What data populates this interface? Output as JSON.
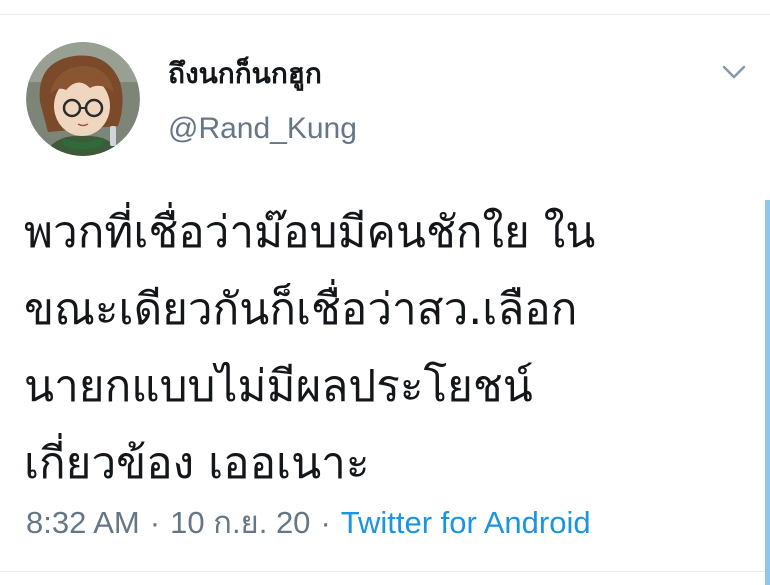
{
  "tweet": {
    "author": {
      "display_name": "ถึงนกก็นกฮูก",
      "handle": "@Rand_Kung"
    },
    "menu_icon": "chevron-down-icon",
    "text_lines": [
      "พวกที่เชื่อว่าม๊อบมีคนชักใย ใน",
      "ขณะเดียวกันก็เชื่อว่าสว.เลือก",
      "นายกแบบไม่มีผลประโยชน์",
      "เกี่ยวข้อง เออเนาะ"
    ],
    "time": "8:32 AM",
    "date": "10 ก.ย. 20",
    "separator": "·",
    "source": "Twitter for Android"
  },
  "colors": {
    "text_primary": "#14171a",
    "text_secondary": "#657786",
    "link": "#1b95e0",
    "divider": "#e6ecf0"
  }
}
